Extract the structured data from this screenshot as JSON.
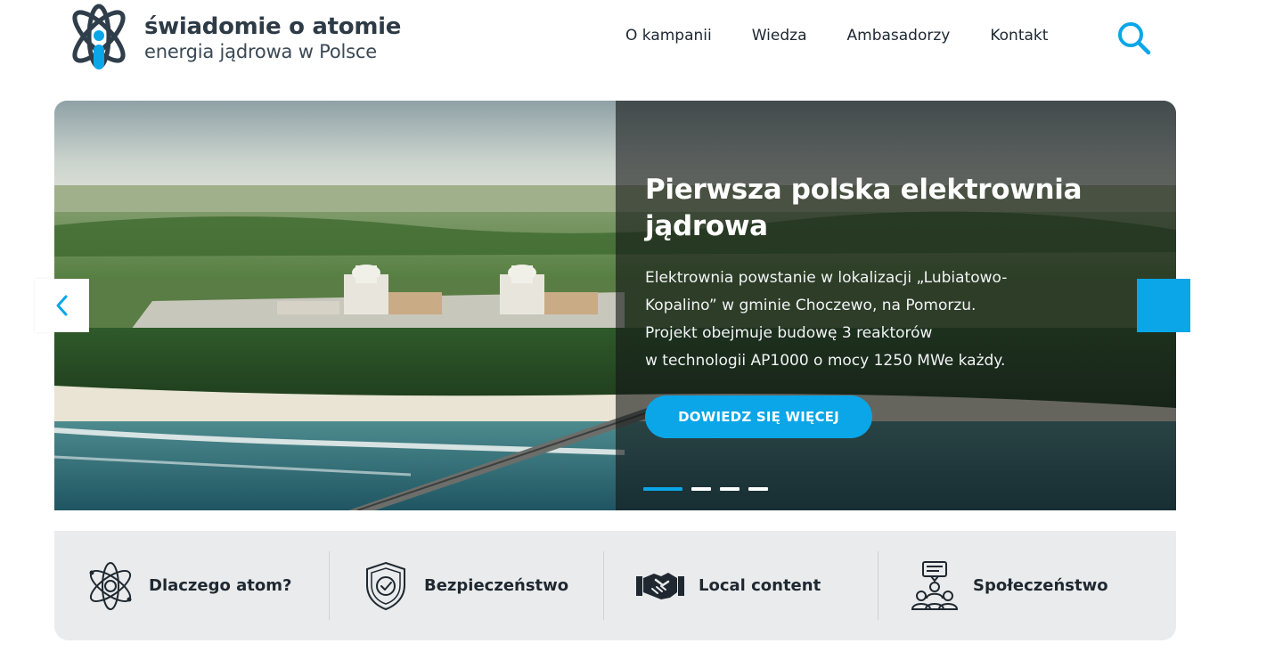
{
  "brand": {
    "title": "świadomie o atomie",
    "subtitle": "energia jądrowa w Polsce"
  },
  "nav": {
    "items": [
      "O kampanii",
      "Wiedza",
      "Ambasadorzy",
      "Kontakt"
    ],
    "search_icon": "search-icon"
  },
  "hero": {
    "title": "Pierwsza polska elektrownia jądrowa",
    "description_lines": [
      "Elektrownia powstanie w lokalizacji „Lubiatowo-",
      "Kopalino” w gminie Choczewo, na Pomorzu.",
      "Projekt obejmuje budowę 3 reaktorów",
      "w technologii AP1000 o mocy 1250 MWe każdy."
    ],
    "cta_label": "DOWIEDZ SIĘ WIĘCEJ",
    "slide_count": 4,
    "active_slide": 1,
    "prev_icon": "chevron-left-icon"
  },
  "categories": [
    {
      "label": "Dlaczego atom?",
      "icon": "atom-icon"
    },
    {
      "label": "Bezpieczeństwo",
      "icon": "shield-check-icon"
    },
    {
      "label": "Local content",
      "icon": "handshake-icon"
    },
    {
      "label": "Społeczeństwo",
      "icon": "community-chat-icon"
    }
  ],
  "colors": {
    "accent": "#0aa6e8",
    "text_dark": "#1f2a36",
    "category_bg": "#e9ebec",
    "overlay": "#141616"
  }
}
